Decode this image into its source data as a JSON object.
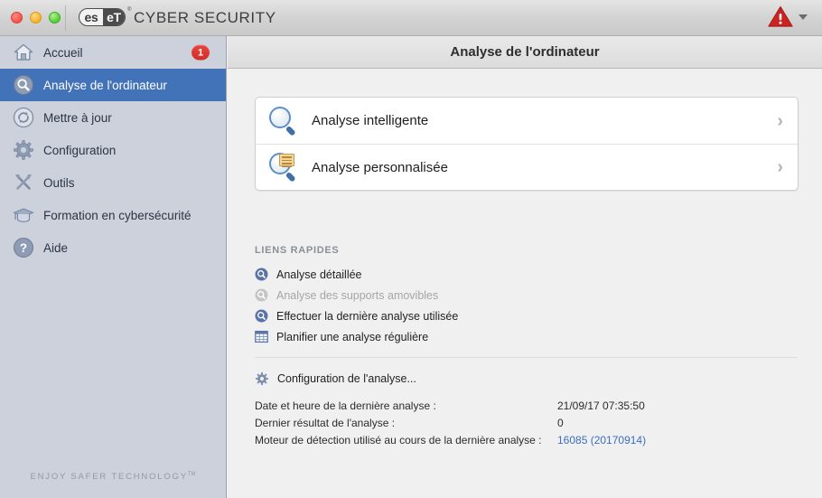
{
  "window": {
    "brand_mark": "eset",
    "brand_es": "es",
    "brand_et": "eT",
    "brand_tm": "®",
    "app_name": "CYBER SECURITY",
    "status_icon": "warning-triangle-icon",
    "status_caret": "chevron-down-icon",
    "traffic_lights": [
      "close",
      "minimize",
      "zoom"
    ]
  },
  "sidebar": {
    "items": [
      {
        "label": "Accueil",
        "icon": "home-icon",
        "selected": false,
        "badge": "1"
      },
      {
        "label": "Analyse de l'ordinateur",
        "icon": "magnifier-circle-icon",
        "selected": true,
        "badge": ""
      },
      {
        "label": "Mettre à jour",
        "icon": "refresh-circle-icon",
        "selected": false,
        "badge": ""
      },
      {
        "label": "Configuration",
        "icon": "gear-icon",
        "selected": false,
        "badge": ""
      },
      {
        "label": "Outils",
        "icon": "tools-icon",
        "selected": false,
        "badge": ""
      },
      {
        "label": "Formation en cybersécurité",
        "icon": "graduation-cap-icon",
        "selected": false,
        "badge": ""
      },
      {
        "label": "Aide",
        "icon": "question-circle-icon",
        "selected": false,
        "badge": ""
      }
    ],
    "tagline": "ENJOY SAFER TECHNOLOGY",
    "tagline_tm": "TM"
  },
  "content": {
    "title": "Analyse de l'ordinateur",
    "scan_options": [
      {
        "label": "Analyse intelligente",
        "icon": "magnifier-icon",
        "chevron": "chevron-right-icon"
      },
      {
        "label": "Analyse personnalisée",
        "icon": "magnifier-document-icon",
        "chevron": "chevron-right-icon"
      }
    ],
    "quick_links_title": "LIENS RAPIDES",
    "quick_links": [
      {
        "label": "Analyse détaillée",
        "icon": "magnifier-badge-icon",
        "disabled": false
      },
      {
        "label": "Analyse des supports amovibles",
        "icon": "magnifier-badge-icon",
        "disabled": true
      },
      {
        "label": "Effectuer la dernière analyse utilisée",
        "icon": "magnifier-badge-icon",
        "disabled": false
      },
      {
        "label": "Planifier une analyse régulière",
        "icon": "calendar-grid-icon",
        "disabled": false
      }
    ],
    "setup_link": {
      "label": "Configuration de l'analyse...",
      "icon": "gear-icon"
    },
    "details": [
      {
        "key": "Date et heure de la dernière analyse :",
        "value": "21/09/17 07:35:50",
        "is_link": false
      },
      {
        "key": "Dernier résultat de l'analyse :",
        "value": "0",
        "is_link": false
      },
      {
        "key": "Moteur de détection utilisé au cours de la dernière analyse :",
        "value": "16085 (20170914)",
        "is_link": true
      }
    ]
  },
  "colors": {
    "selection_blue": "#4272b8",
    "badge_red": "#d8372f",
    "link_blue": "#3b6ec0",
    "sidebar_bg": "#ccd1dc",
    "content_bg": "#f0f0f0"
  }
}
